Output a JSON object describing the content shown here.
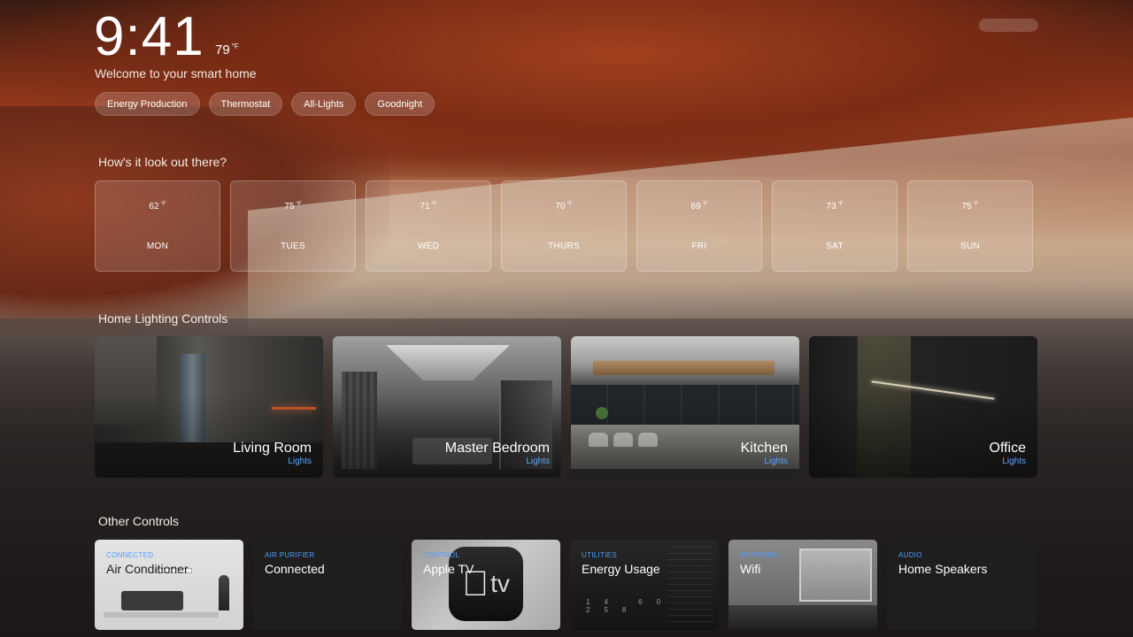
{
  "header": {
    "time": "9:41",
    "temperature": "79",
    "temperature_unit": "°F",
    "welcome": "Welcome to your smart home"
  },
  "quick_actions": [
    {
      "label": "Energy Production"
    },
    {
      "label": "Thermostat"
    },
    {
      "label": "All-Lights"
    },
    {
      "label": "Goodnight"
    }
  ],
  "weather": {
    "title": "How's it look out there?",
    "days": [
      {
        "temp": "62",
        "unit": "°F",
        "day": "MON"
      },
      {
        "temp": "75",
        "unit": "°F",
        "day": "TUES"
      },
      {
        "temp": "71",
        "unit": "°F",
        "day": "WED"
      },
      {
        "temp": "70",
        "unit": "°F",
        "day": "THURS"
      },
      {
        "temp": "69",
        "unit": "°F",
        "day": "FRI"
      },
      {
        "temp": "73",
        "unit": "°F",
        "day": "SAT"
      },
      {
        "temp": "75",
        "unit": "°F",
        "day": "SUN"
      }
    ]
  },
  "lighting": {
    "title": "Home Lighting Controls",
    "rooms": [
      {
        "name": "Living Room",
        "sub": "Lights"
      },
      {
        "name": "Master Bedroom",
        "sub": "Lights"
      },
      {
        "name": "Kitchen",
        "sub": "Lights"
      },
      {
        "name": "Office",
        "sub": "Lights"
      }
    ]
  },
  "other": {
    "title": "Other Controls",
    "items": [
      {
        "category": "CONNECTED",
        "name": "Air Conditioner"
      },
      {
        "category": "AIR PURIFIER",
        "name": "Connected"
      },
      {
        "category": "CONTROL",
        "name": "Apple TV",
        "badge": "tv"
      },
      {
        "category": "UTILITIES",
        "name": "Energy Usage",
        "readings": [
          "14",
          "60",
          "258"
        ]
      },
      {
        "category": "NETWORK",
        "name": "Wifi"
      },
      {
        "category": "AUDIO",
        "name": "Home Speakers"
      }
    ]
  },
  "colors": {
    "accent_blue": "#4f9dff",
    "room_sub_blue": "#5aa7ff"
  },
  "icons": {
    "apple_logo": "apple-logo-icon"
  }
}
